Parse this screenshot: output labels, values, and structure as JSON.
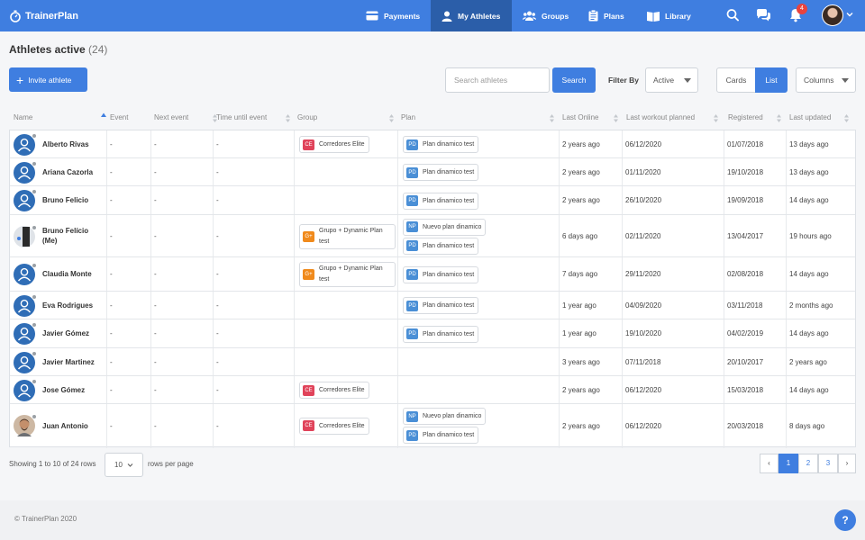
{
  "app": {
    "name": "TrainerPlan"
  },
  "nav": {
    "payments": "Payments",
    "athletes": "My Athletes",
    "groups": "Groups",
    "plans": "Plans",
    "library": "Library",
    "notifications_count": "4"
  },
  "page": {
    "title": "Athletes active",
    "count": "(24)"
  },
  "toolbar": {
    "invite_label": "Invite athlete",
    "search_placeholder": "Search athletes",
    "search_button": "Search",
    "filter_label": "Filter By",
    "filter_value": "Active",
    "view_cards": "Cards",
    "view_list": "List",
    "columns_label": "Columns"
  },
  "table": {
    "headers": [
      "Name",
      "Event",
      "Next event",
      "Time until event",
      "Group",
      "Plan",
      "Last Online",
      "Last workout planned",
      "Registered",
      "Last updated"
    ],
    "rows": [
      {
        "name": "Alberto Rivas",
        "event": "-",
        "next": "-",
        "time": "-",
        "groups": [
          {
            "abbr": "CE",
            "label": "Corredores Elite"
          }
        ],
        "plans": [
          {
            "abbr": "PD",
            "label": "Plan dinamico test"
          }
        ],
        "last_online": "2 years ago",
        "last_workout": "06/12/2020",
        "registered": "01/07/2018",
        "updated": "13 days ago"
      },
      {
        "name": "Ariana Cazorla",
        "event": "-",
        "next": "-",
        "time": "-",
        "groups": [],
        "plans": [
          {
            "abbr": "PD",
            "label": "Plan dinamico test"
          }
        ],
        "last_online": "2 years ago",
        "last_workout": "01/11/2020",
        "registered": "19/10/2018",
        "updated": "13 days ago"
      },
      {
        "name": "Bruno Felicio",
        "event": "-",
        "next": "-",
        "time": "-",
        "groups": [],
        "plans": [
          {
            "abbr": "PD",
            "label": "Plan dinamico test"
          }
        ],
        "last_online": "2 years ago",
        "last_workout": "26/10/2020",
        "registered": "19/09/2018",
        "updated": "14 days ago"
      },
      {
        "name": "Bruno Felício (Me)",
        "event": "-",
        "next": "-",
        "time": "-",
        "groups": [
          {
            "abbr": "G+",
            "label": "Grupo + Dynamic Plan test"
          }
        ],
        "plans": [
          {
            "abbr": "NP",
            "label": "Nuevo plan dinamico"
          },
          {
            "abbr": "PD",
            "label": "Plan dinamico test"
          }
        ],
        "last_online": "6 days ago",
        "last_workout": "02/11/2020",
        "registered": "13/04/2017",
        "updated": "19 hours ago"
      },
      {
        "name": "Claudia Monte",
        "event": "-",
        "next": "-",
        "time": "-",
        "groups": [
          {
            "abbr": "G+",
            "label": "Grupo + Dynamic Plan test"
          }
        ],
        "plans": [
          {
            "abbr": "PD",
            "label": "Plan dinamico test"
          }
        ],
        "last_online": "7 days ago",
        "last_workout": "29/11/2020",
        "registered": "02/08/2018",
        "updated": "14 days ago"
      },
      {
        "name": "Eva Rodrigues",
        "event": "-",
        "next": "-",
        "time": "-",
        "groups": [],
        "plans": [
          {
            "abbr": "PD",
            "label": "Plan dinamico test"
          }
        ],
        "last_online": "1 year ago",
        "last_workout": "04/09/2020",
        "registered": "03/11/2018",
        "updated": "2 months ago"
      },
      {
        "name": "Javier Gómez",
        "event": "-",
        "next": "-",
        "time": "-",
        "groups": [],
        "plans": [
          {
            "abbr": "PD",
            "label": "Plan dinamico test"
          }
        ],
        "last_online": "1 year ago",
        "last_workout": "19/10/2020",
        "registered": "04/02/2019",
        "updated": "14 days ago"
      },
      {
        "name": "Javier Martinez",
        "event": "-",
        "next": "-",
        "time": "-",
        "groups": [],
        "plans": [],
        "last_online": "3 years ago",
        "last_workout": "07/11/2018",
        "registered": "20/10/2017",
        "updated": "2 years ago"
      },
      {
        "name": "Jose Gómez",
        "event": "-",
        "next": "-",
        "time": "-",
        "groups": [
          {
            "abbr": "CE",
            "label": "Corredores Elite"
          }
        ],
        "plans": [],
        "last_online": "2 years ago",
        "last_workout": "06/12/2020",
        "registered": "15/03/2018",
        "updated": "14 days ago"
      },
      {
        "name": "Juan Antonio",
        "event": "-",
        "next": "-",
        "time": "-",
        "groups": [
          {
            "abbr": "CE",
            "label": "Corredores Elite"
          }
        ],
        "plans": [
          {
            "abbr": "NP",
            "label": "Nuevo plan dinamico"
          },
          {
            "abbr": "PD",
            "label": "Plan dinamico test"
          }
        ],
        "last_online": "2 years ago",
        "last_workout": "06/12/2020",
        "registered": "20/03/2018",
        "updated": "8 days ago"
      }
    ]
  },
  "pagination": {
    "showing": "Showing 1 to 10 of 24 rows",
    "rows_per_page": "10",
    "rows_per_page_label": "rows per page",
    "pages": [
      "1",
      "2",
      "3"
    ],
    "prev": "‹",
    "next": "›"
  },
  "footer": {
    "copyright": "© TrainerPlan 2020",
    "help": "?"
  },
  "colors": {
    "primary": "#3f7ee0",
    "nav_active": "#2b5ea9",
    "tag_ce": "#e0435a",
    "tag_gp": "#f08a1c",
    "tag_pd": "#4a8fd6",
    "tag_np": "#4a8fd6"
  }
}
